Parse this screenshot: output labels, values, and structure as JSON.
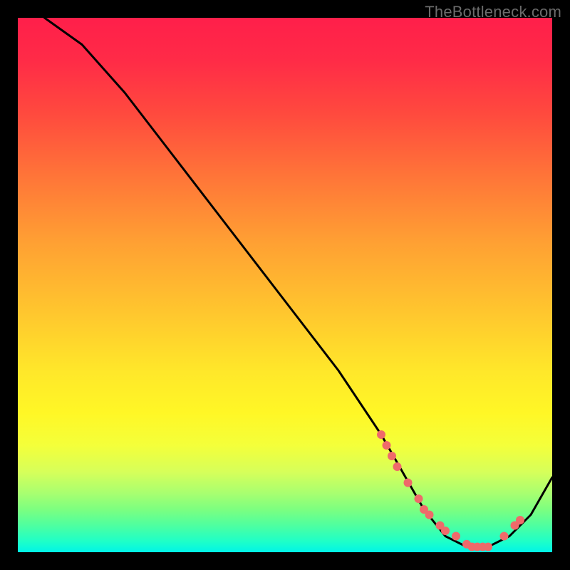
{
  "watermark": "TheBottleneck.com",
  "chart_data": {
    "type": "line",
    "title": "",
    "xlabel": "",
    "ylabel": "",
    "xlim": [
      0,
      100
    ],
    "ylim": [
      0,
      100
    ],
    "grid": false,
    "legend": false,
    "background": "heat-gradient-red-to-green",
    "series": [
      {
        "name": "bottleneck-curve",
        "stroke": "#000000",
        "x": [
          5,
          12,
          20,
          30,
          40,
          50,
          60,
          68,
          72,
          76,
          80,
          84,
          88,
          92,
          96,
          100
        ],
        "values": [
          100,
          95,
          86,
          73,
          60,
          47,
          34,
          22,
          15,
          8,
          3,
          1,
          1,
          3,
          7,
          14
        ]
      }
    ],
    "marker_series": [
      {
        "name": "highlight-points",
        "color": "#ef6a6a",
        "radius_px": 6,
        "x": [
          68,
          69,
          70,
          71,
          73,
          75,
          76,
          77,
          79,
          80,
          82,
          84,
          85,
          86,
          87,
          88,
          91,
          93,
          94
        ],
        "values": [
          22,
          20,
          18,
          16,
          13,
          10,
          8,
          7,
          5,
          4,
          3,
          1.5,
          1,
          1,
          1,
          1,
          3,
          5,
          6
        ]
      }
    ]
  }
}
